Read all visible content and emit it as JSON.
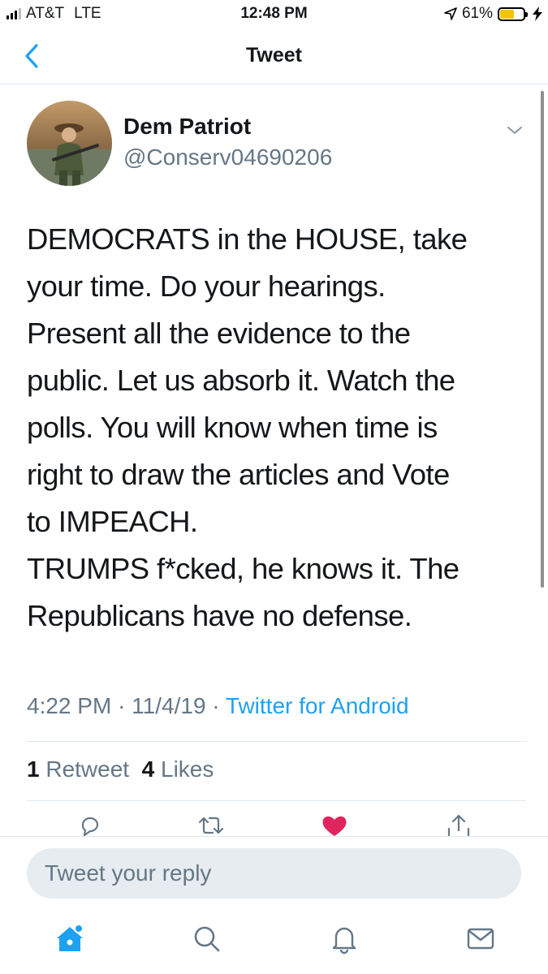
{
  "status_bar": {
    "carrier": "AT&T",
    "network": "LTE",
    "time": "12:48 PM",
    "battery_percent": "61%",
    "battery_level": 0.61,
    "battery_color": "#f5c400"
  },
  "header": {
    "title": "Tweet",
    "back_icon": "chevron-left-icon"
  },
  "tweet": {
    "author_name": "Dem Patriot",
    "author_handle": "@Conserv04690206",
    "text": "DEMOCRATS in the HOUSE, take\nyour time.  Do your hearings.\nPresent all the evidence to the\npublic. Let us absorb it. Watch the\npolls. You will know when time is\nright to draw the articles and Vote\nto IMPEACH.\nTRUMPS f*cked, he knows it. The\nRepublicans have no defense.",
    "time": "4:22 PM",
    "separator": "·",
    "date": "11/4/19",
    "source": "Twitter for Android",
    "retweet_count": "1",
    "retweet_label": "Retweet",
    "like_count": "4",
    "like_label": "Likes"
  },
  "actions": [
    {
      "name": "reply-icon"
    },
    {
      "name": "retweet-icon"
    },
    {
      "name": "like-icon",
      "active": true,
      "color": "#e0245e"
    },
    {
      "name": "share-icon"
    }
  ],
  "reply": {
    "placeholder": "Tweet your reply"
  },
  "tabbar": {
    "items": [
      "home-icon",
      "search-icon",
      "notifications-icon",
      "messages-icon"
    ],
    "accent": "#1da1f2"
  },
  "colors": {
    "accent": "#1da1f2",
    "secondary_text": "#657786",
    "divider": "#e1e8ed",
    "like": "#e0245e"
  }
}
